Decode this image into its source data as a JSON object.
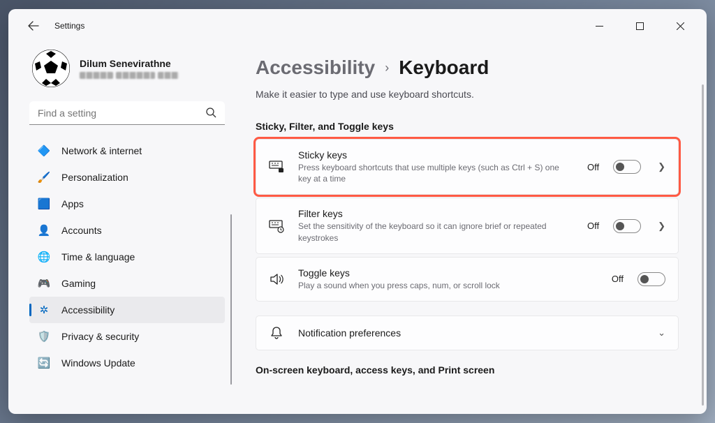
{
  "app_title": "Settings",
  "profile": {
    "name": "Dilum Senevirathne"
  },
  "search": {
    "placeholder": "Find a setting"
  },
  "sidebar": {
    "items": [
      {
        "label": "Network & internet"
      },
      {
        "label": "Personalization"
      },
      {
        "label": "Apps"
      },
      {
        "label": "Accounts"
      },
      {
        "label": "Time & language"
      },
      {
        "label": "Gaming"
      },
      {
        "label": "Accessibility"
      },
      {
        "label": "Privacy & security"
      },
      {
        "label": "Windows Update"
      }
    ]
  },
  "breadcrumb": {
    "parent": "Accessibility",
    "current": "Keyboard"
  },
  "page_desc": "Make it easier to type and use keyboard shortcuts.",
  "section1_title": "Sticky, Filter, and Toggle keys",
  "cards": {
    "sticky": {
      "title": "Sticky keys",
      "desc": "Press keyboard shortcuts that use multiple keys (such as Ctrl + S) one key at a time",
      "state": "Off"
    },
    "filter": {
      "title": "Filter keys",
      "desc": "Set the sensitivity of the keyboard so it can ignore brief or repeated keystrokes",
      "state": "Off"
    },
    "toggle": {
      "title": "Toggle keys",
      "desc": "Play a sound when you press caps, num, or scroll lock",
      "state": "Off"
    },
    "notif": {
      "title": "Notification preferences"
    }
  },
  "section2_title": "On-screen keyboard, access keys, and Print screen"
}
